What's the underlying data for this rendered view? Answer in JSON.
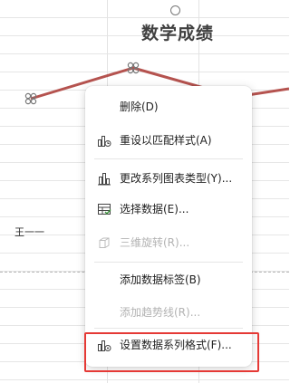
{
  "chart": {
    "title": "数学成绩",
    "legend_label": "王一一",
    "line_color": "#b5534f",
    "marker_icon": "flower-marker-icon"
  },
  "context_menu": {
    "items": [
      {
        "label": "删除(D)",
        "icon": "none",
        "enabled": true
      },
      {
        "label": "重设以匹配样式(A)",
        "icon": "reset-style-icon",
        "enabled": true
      },
      {
        "label": "更改系列图表类型(Y)...",
        "icon": "chart-type-icon",
        "enabled": true
      },
      {
        "label": "选择数据(E)...",
        "icon": "select-data-icon",
        "enabled": true
      },
      {
        "label": "三维旋转(R)...",
        "icon": "3d-rotate-icon",
        "enabled": false
      },
      {
        "label": "添加数据标签(B)",
        "icon": "none",
        "enabled": true
      },
      {
        "label": "添加趋势线(R)...",
        "icon": "none",
        "enabled": false
      },
      {
        "label": "设置数据系列格式(F)...",
        "icon": "format-series-icon",
        "enabled": true
      }
    ]
  },
  "highlight_color": "#e53935"
}
